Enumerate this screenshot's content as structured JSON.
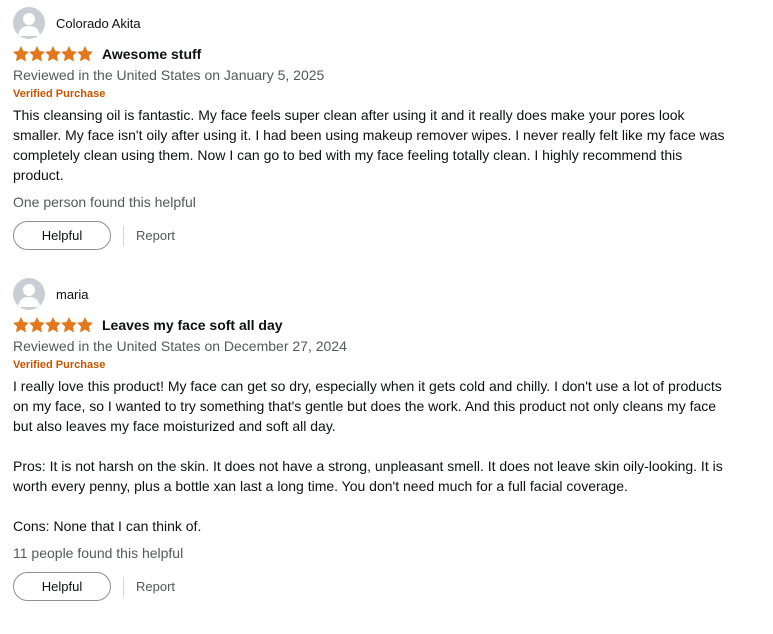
{
  "reviews": [
    {
      "reviewer": "Colorado Akita",
      "rating": 5,
      "title": "Awesome stuff",
      "date": "Reviewed in the United States on January 5, 2025",
      "badge": "Verified Purchase",
      "body": [
        "This cleansing oil is fantastic. My face feels super clean after using it and it really does make your pores look smaller. My face isn't oily after using it. I had been using makeup remover wipes. I never really felt like my face was completely clean using them. Now I can go to bed with my face feeling totally clean. I highly recommend this product."
      ],
      "helpful_count": "One person found this helpful",
      "helpful_label": "Helpful",
      "report_label": "Report"
    },
    {
      "reviewer": "maria",
      "rating": 5,
      "title": "Leaves my face soft all day",
      "date": "Reviewed in the United States on December 27, 2024",
      "badge": "Verified Purchase",
      "body": [
        "I really love this product! My face can get so dry, especially when it gets cold and chilly. I don't use a lot of products on my face, so I wanted to try something that's gentle but does the work. And this product not only cleans my face but also leaves my face moisturized and soft all day.",
        "Pros: It is not harsh on the skin. It does not have a strong, unpleasant smell. It does not leave skin oily-looking. It is worth every penny, plus a bottle xan last a long time. You don't need much for a full facial coverage.",
        "Cons: None that I can think of."
      ],
      "helpful_count": "11 people found this helpful",
      "helpful_label": "Helpful",
      "report_label": "Report"
    }
  ],
  "colors": {
    "star": "#de7921",
    "verified": "#c45500",
    "secondary_text": "#565959"
  },
  "icons": {
    "avatar": "default-profile-icon",
    "star": "star-icon"
  }
}
